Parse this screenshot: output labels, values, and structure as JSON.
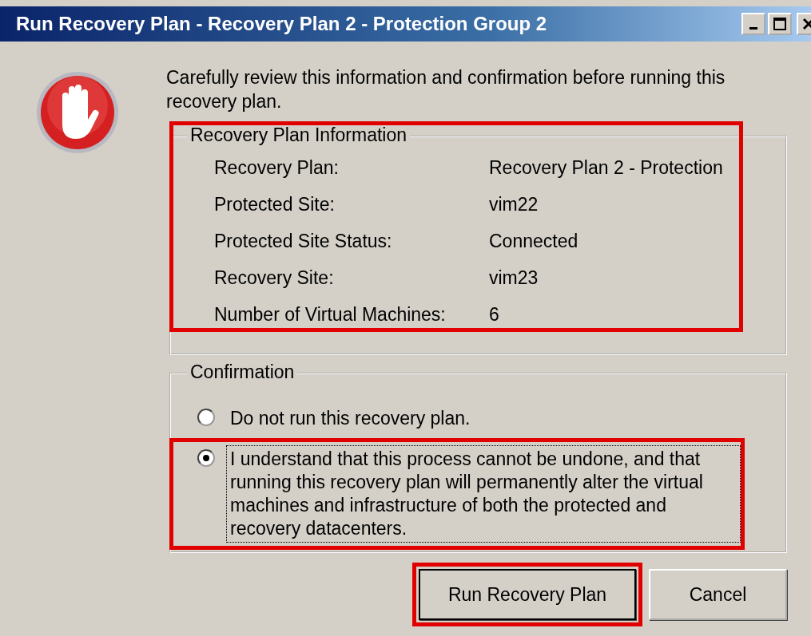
{
  "window": {
    "title": "Run Recovery Plan - Recovery Plan 2 - Protection Group 2"
  },
  "intro": "Carefully review this information and confirmation before running this recovery plan.",
  "information": {
    "title": "Recovery Plan Information",
    "highlighted": true,
    "rows": [
      {
        "label": "Recovery Plan:",
        "value": "Recovery Plan 2 - Protection"
      },
      {
        "label": "Protected Site:",
        "value": "vim22"
      },
      {
        "label": "Protected Site Status:",
        "value": "Connected"
      },
      {
        "label": "Recovery Site:",
        "value": "vim23"
      },
      {
        "label": "Number of Virtual Machines:",
        "value": "6"
      }
    ]
  },
  "confirmation": {
    "title": "Confirmation",
    "options": [
      {
        "label": "Do not run this recovery plan.",
        "selected": false,
        "highlighted": false
      },
      {
        "label": "I understand that this process cannot be undone, and that running this recovery plan will permanently alter the virtual machines and infrastructure of both the protected and recovery datacenters.",
        "selected": true,
        "highlighted": true
      }
    ]
  },
  "buttons": [
    {
      "label": "Run Recovery Plan",
      "highlighted": true
    },
    {
      "label": "Cancel",
      "highlighted": false
    }
  ]
}
